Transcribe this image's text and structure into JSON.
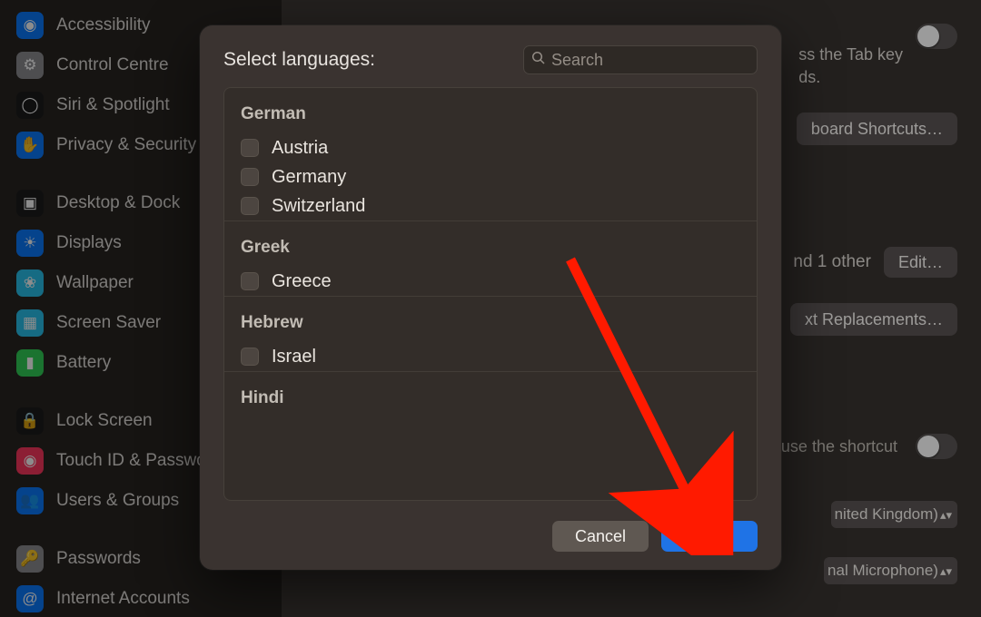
{
  "sidebar": {
    "groups": [
      [
        {
          "icon": "accessibility",
          "color": "#0a7aff",
          "label": "Accessibility"
        },
        {
          "icon": "control",
          "color": "#8e8e93",
          "label": "Control Centre"
        },
        {
          "icon": "siri",
          "color": "#1c1c1c",
          "label": "Siri & Spotlight"
        },
        {
          "icon": "privacy",
          "color": "#0a7aff",
          "label": "Privacy & Security"
        }
      ],
      [
        {
          "icon": "dock",
          "color": "#1c1c1c",
          "label": "Desktop & Dock"
        },
        {
          "icon": "displays",
          "color": "#0a7aff",
          "label": "Displays"
        },
        {
          "icon": "wallpaper",
          "color": "#29c3ee",
          "label": "Wallpaper"
        },
        {
          "icon": "screensaver",
          "color": "#29c3ee",
          "label": "Screen Saver"
        },
        {
          "icon": "battery",
          "color": "#32d158",
          "label": "Battery"
        }
      ],
      [
        {
          "icon": "lock",
          "color": "#1c1c1c",
          "label": "Lock Screen"
        },
        {
          "icon": "touchid",
          "color": "#ff375f",
          "label": "Touch ID & Password"
        },
        {
          "icon": "users",
          "color": "#0a7aff",
          "label": "Users & Groups"
        }
      ],
      [
        {
          "icon": "passwords",
          "color": "#8e8e93",
          "label": "Passwords"
        },
        {
          "icon": "internet",
          "color": "#0a7aff",
          "label": "Internet Accounts"
        }
      ]
    ]
  },
  "pane": {
    "tabkey_fragment1": "ss the Tab key",
    "tabkey_fragment2": "ds.",
    "shortcuts_btn": "board Shortcuts…",
    "edit_btn": "Edit…",
    "row2_fragment": "nd 1 other",
    "replacements_btn": "xt Replacements…",
    "shortcut_fragment": "use the shortcut",
    "select1_fragment": "nited Kingdom)",
    "select2_fragment": "nal Microphone)"
  },
  "modal": {
    "title": "Select languages:",
    "search_placeholder": "Search",
    "groups": [
      {
        "name": "German",
        "items": [
          "Austria",
          "Germany",
          "Switzerland"
        ]
      },
      {
        "name": "Greek",
        "items": [
          "Greece"
        ]
      },
      {
        "name": "Hebrew",
        "items": [
          "Israel"
        ]
      },
      {
        "name": "Hindi",
        "items": []
      }
    ],
    "cancel": "Cancel",
    "ok": "OK"
  }
}
